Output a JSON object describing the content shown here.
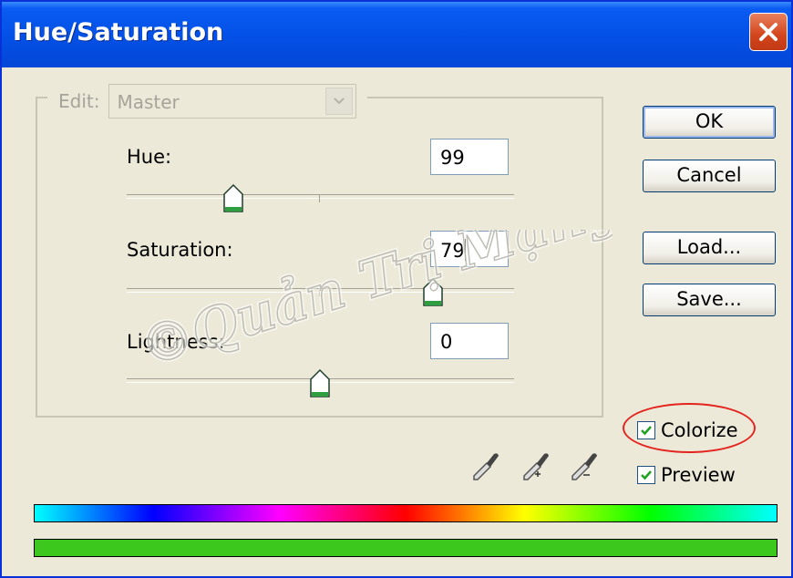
{
  "window": {
    "title": "Hue/Saturation"
  },
  "edit": {
    "label": "Edit:",
    "value": "Master"
  },
  "adjustments": {
    "hue": {
      "label": "Hue:",
      "value": "99"
    },
    "saturation": {
      "label": "Saturation:",
      "value": "79"
    },
    "lightness": {
      "label": "Lightness:",
      "value": "0"
    }
  },
  "buttons": {
    "ok": "OK",
    "cancel": "Cancel",
    "load": "Load...",
    "save": "Save..."
  },
  "checkboxes": {
    "colorize": {
      "label": "Colorize",
      "checked": true
    },
    "preview": {
      "label": "Preview",
      "checked": true
    }
  },
  "watermark": {
    "text": "©Quản Trị Mạng"
  },
  "colors": {
    "title_bar": "#0450E6",
    "close_button": "#D3441B",
    "slider_thumb": "#2E9E40",
    "colorize_result": "#3DC81E",
    "highlight": "#E4241E"
  },
  "icons": [
    "close-icon",
    "eyedropper-icon",
    "eyedropper-plus-icon",
    "eyedropper-minus-icon",
    "chevron-down-icon"
  ]
}
